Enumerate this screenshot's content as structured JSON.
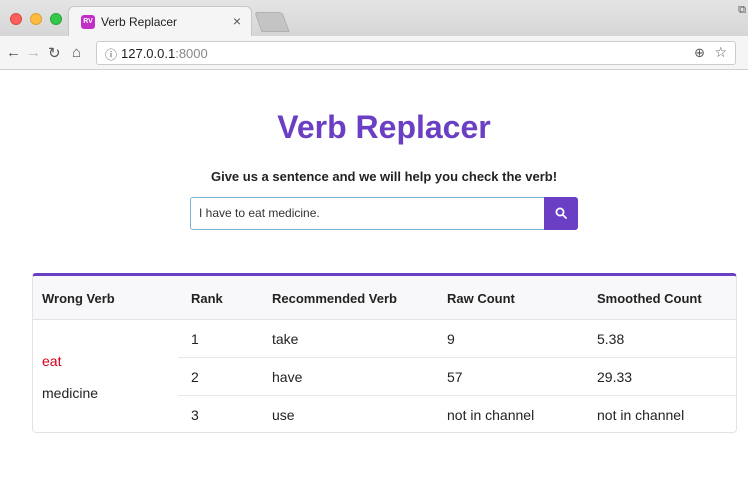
{
  "browser": {
    "tab_title": "Verb Replacer",
    "tab_favicon": "RV",
    "tab_close": "×",
    "url_host": "127.0.0.1",
    "url_port": ":8000"
  },
  "page": {
    "title": "Verb Replacer",
    "subtitle": "Give us a sentence and we will help you check the verb!",
    "search_value": "I have to eat medicine.",
    "accent_color": "#6a3fc4"
  },
  "table": {
    "headers": [
      "Wrong Verb",
      "Rank",
      "Recommended Verb",
      "Raw Count",
      "Smoothed Count"
    ],
    "wrong_verb": "eat",
    "wrong_object": "medicine",
    "rows": [
      {
        "rank": "1",
        "verb": "take",
        "raw": "9",
        "smoothed": "5.38"
      },
      {
        "rank": "2",
        "verb": "have",
        "raw": "57",
        "smoothed": "29.33"
      },
      {
        "rank": "3",
        "verb": "use",
        "raw": "not in channel",
        "smoothed": "not in channel"
      }
    ]
  }
}
